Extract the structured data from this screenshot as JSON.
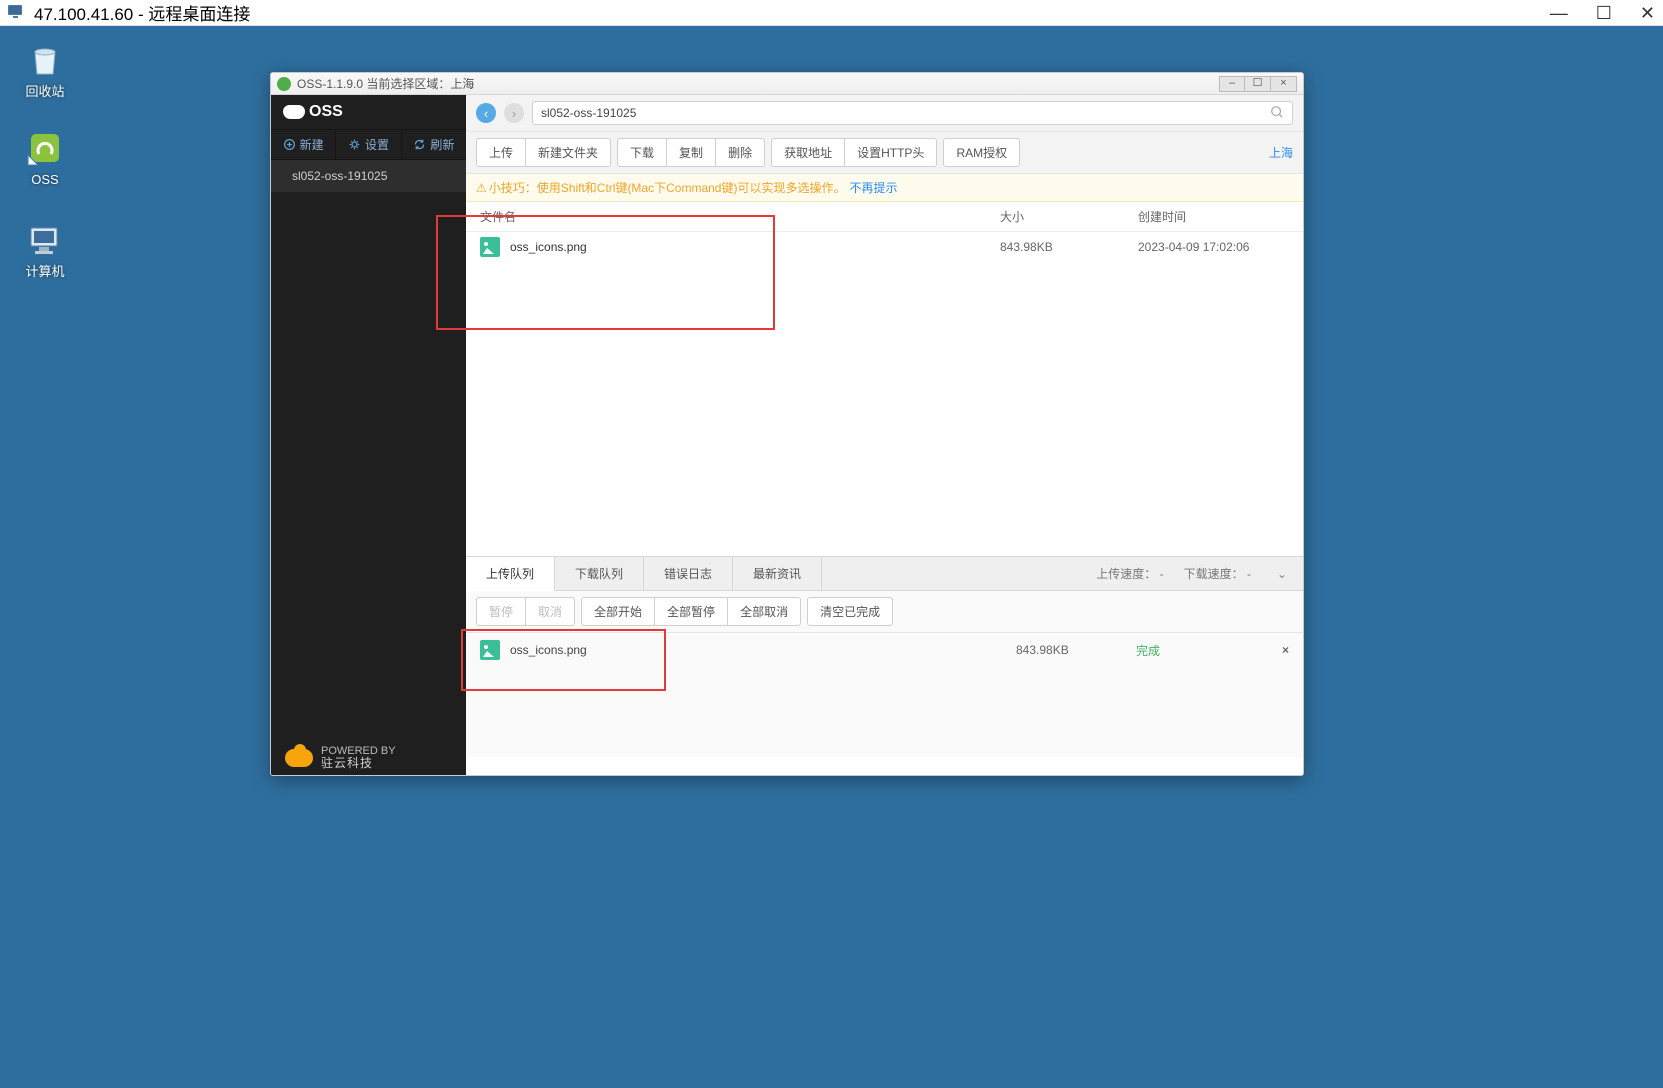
{
  "rdp": {
    "title": "47.100.41.60 - 远程桌面连接"
  },
  "desktop": {
    "recycle_bin": "回收站",
    "oss": "OSS",
    "computer": "计算机"
  },
  "oss_win_title": "OSS-1.1.9.0 当前选择区域：上海",
  "sidebar": {
    "brand": "OSS",
    "menu_new": "新建",
    "menu_settings": "设置",
    "menu_refresh": "刷新",
    "bucket": "sl052-oss-191025",
    "footer_small": "POWERED BY",
    "footer_big": "驻云科技"
  },
  "path": {
    "value": "sl052-oss-191025"
  },
  "toolbar": {
    "upload": "上传",
    "new_folder": "新建文件夹",
    "download": "下载",
    "copy": "复制",
    "delete": "删除",
    "get_url": "获取地址",
    "set_http": "设置HTTP头",
    "ram": "RAM授权",
    "region": "上海"
  },
  "tip": {
    "main": "小技巧：使用Shift和Ctrl键(Mac下Command键)可以实现多选操作。",
    "link": "不再提示"
  },
  "columns": {
    "name": "文件名",
    "size": "大小",
    "time": "创建时间"
  },
  "files": [
    {
      "name": "oss_icons.png",
      "size": "843.98KB",
      "time": "2023-04-09 17:02:06"
    }
  ],
  "tabs": {
    "upload_q": "上传队列",
    "download_q": "下载队列",
    "error_log": "错误日志",
    "news": "最新资讯",
    "up_speed_label": "上传速度：",
    "down_speed_label": "下载速度：",
    "dash": "-"
  },
  "qbar": {
    "pause": "暂停",
    "cancel": "取消",
    "start_all": "全部开始",
    "pause_all": "全部暂停",
    "cancel_all": "全部取消",
    "clear_done": "清空已完成"
  },
  "queue": [
    {
      "name": "oss_icons.png",
      "size": "843.98KB",
      "status": "完成"
    }
  ]
}
